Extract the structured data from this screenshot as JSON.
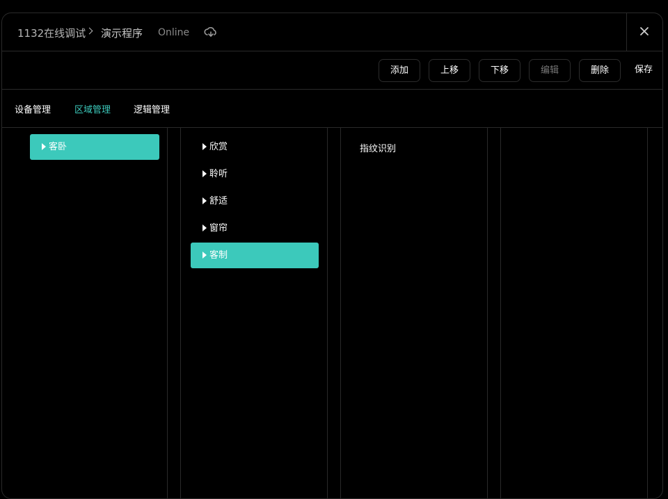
{
  "header": {
    "project": "1132在线调试",
    "program": "演示程序",
    "status": "Online",
    "status_icon": "cloud-sync-icon",
    "close_icon": "close-icon"
  },
  "toolbar": {
    "add_label": "添加",
    "move_up_label": "上移",
    "move_down_label": "下移",
    "edit_label": "编辑",
    "delete_label": "删除",
    "save_label": "保存"
  },
  "tabs": [
    {
      "label": "设备管理",
      "active": false
    },
    {
      "label": "区域管理",
      "active": true
    },
    {
      "label": "逻辑管理",
      "active": false
    }
  ],
  "columns": {
    "rooms": [
      {
        "label": "客卧",
        "selected": true
      }
    ],
    "groups": [
      {
        "label": "欣赏",
        "selected": false
      },
      {
        "label": "聆听",
        "selected": false
      },
      {
        "label": "舒适",
        "selected": false
      },
      {
        "label": "窗帘",
        "selected": false
      },
      {
        "label": "客制",
        "selected": true
      }
    ],
    "items": [
      {
        "label": "指纹识别"
      }
    ]
  },
  "colors": {
    "accent": "#3cc9bb",
    "background": "#000000",
    "border": "#2a2a2a"
  }
}
